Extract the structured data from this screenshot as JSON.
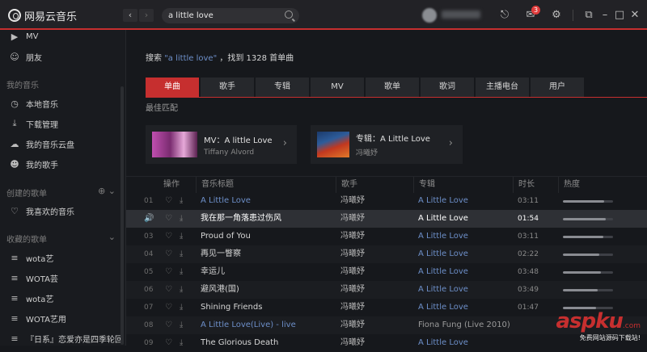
{
  "app": {
    "name": "网易云音乐"
  },
  "search": {
    "value": "a little love"
  },
  "titlebar": {
    "notification_count": "3"
  },
  "sidebar": {
    "top_items": [
      {
        "label": "MV",
        "icon": "video-icon"
      },
      {
        "label": "朋友",
        "icon": "friends-icon"
      }
    ],
    "my_music_header": "我的音乐",
    "my_music": [
      {
        "label": "本地音乐",
        "icon": "clock-icon"
      },
      {
        "label": "下载管理",
        "icon": "download-icon"
      },
      {
        "label": "我的音乐云盘",
        "icon": "cloud-icon"
      },
      {
        "label": "我的歌手",
        "icon": "singer-icon"
      }
    ],
    "created_header": "创建的歌单",
    "created": [
      {
        "label": "我喜欢的音乐",
        "icon": "heart-icon"
      }
    ],
    "collected_header": "收藏的歌单",
    "collected": [
      {
        "label": "wota艺"
      },
      {
        "label": "WOTA芸"
      },
      {
        "label": "wota艺"
      },
      {
        "label": "WOTA艺用"
      },
      {
        "label": "『日系』恋爱亦是四季轮回"
      }
    ]
  },
  "main": {
    "summary_prefix": "搜索",
    "summary_keyword": "\"a little love\"",
    "summary_suffix": "，找到 1328 首单曲",
    "tabs": [
      "单曲",
      "歌手",
      "专辑",
      "MV",
      "歌单",
      "歌词",
      "主播电台",
      "用户"
    ],
    "best_match_label": "最佳匹配",
    "cards": [
      {
        "title": "MV：A little Love",
        "subtitle": "Tiffany Alvord"
      },
      {
        "title": "专辑：A Little Love",
        "subtitle": "冯曦妤"
      }
    ],
    "columns": [
      "操作",
      "音乐标题",
      "歌手",
      "专辑",
      "时长",
      "热度"
    ],
    "rows": [
      {
        "num": "01",
        "title": "A Little Love",
        "artist": "冯曦妤",
        "album": "A Little Love",
        "duration": "03:11",
        "heat": 0.82
      },
      {
        "num": "",
        "title": "我在那一角落患过伤风",
        "artist": "冯曦妤",
        "album": "A Little Love",
        "duration": "01:54",
        "heat": 0.86
      },
      {
        "num": "03",
        "title": "Proud of You",
        "artist": "冯曦妤",
        "album": "A Little Love",
        "duration": "03:11",
        "heat": 0.8
      },
      {
        "num": "04",
        "title": "再见一瞥察",
        "artist": "冯曦妤",
        "album": "A Little Love",
        "duration": "02:22",
        "heat": 0.72
      },
      {
        "num": "05",
        "title": "幸运儿",
        "artist": "冯曦妤",
        "album": "A Little Love",
        "duration": "03:48",
        "heat": 0.76
      },
      {
        "num": "06",
        "title": "避风港(国)",
        "artist": "冯曦妤",
        "album": "A Little Love",
        "duration": "03:49",
        "heat": 0.7
      },
      {
        "num": "07",
        "title": "Shining Friends",
        "artist": "冯曦妤",
        "album": "A Little Love",
        "duration": "01:47",
        "heat": 0.66
      },
      {
        "num": "08",
        "title": "A Little Love(Live) - live",
        "artist": "冯曦妤",
        "album": "Fiona Fung (Live 2010)",
        "duration": "",
        "heat": 0.0
      },
      {
        "num": "09",
        "title": "The Glorious Death",
        "artist": "冯曦妤",
        "album": "A Little Love",
        "duration": "",
        "heat": 0.0
      }
    ]
  },
  "watermark": {
    "logo": "aspku",
    "logo_suffix": ".com",
    "tagline": "免费网站源码下载站!"
  }
}
